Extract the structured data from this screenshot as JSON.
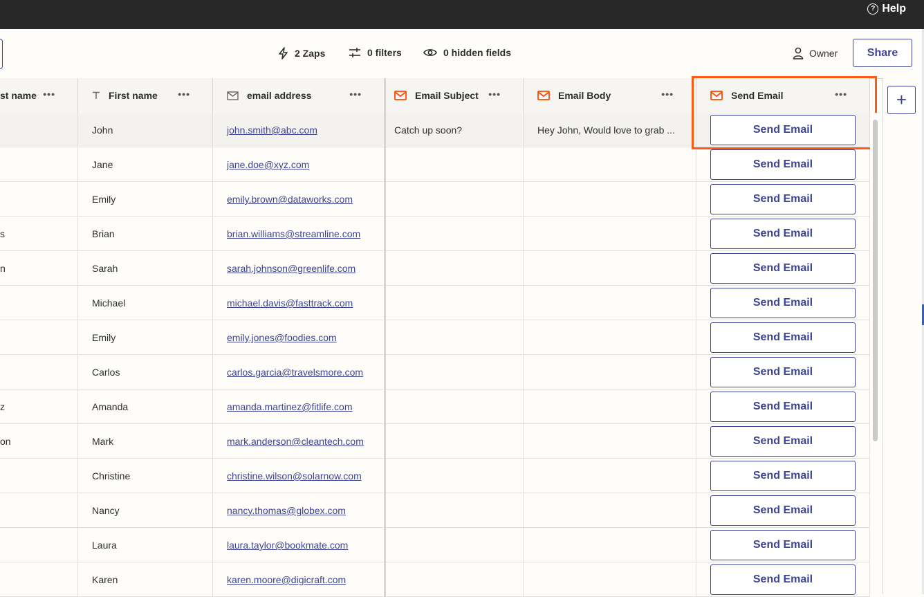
{
  "topbar": {
    "help_label": "Help",
    "help_glyph": "?"
  },
  "toolbar": {
    "zaps_label": "2 Zaps",
    "filters_label": "0 filters",
    "hidden_label": "0 hidden fields",
    "owner_label": "Owner",
    "share_label": "Share"
  },
  "columns": {
    "last_name": "st name",
    "first_name": "First name",
    "email": "email address",
    "subject": "Email Subject",
    "body": "Email Body",
    "send": "Send Email",
    "dots": "•••"
  },
  "rows": [
    {
      "last": "",
      "first": "John",
      "email": "john.smith@abc.com",
      "subject": "Catch up soon?",
      "body": "Hey John, Would love to grab ...",
      "button": "Send Email"
    },
    {
      "last": "",
      "first": "Jane",
      "email": "jane.doe@xyz.com",
      "subject": "",
      "body": "",
      "button": "Send Email"
    },
    {
      "last": "",
      "first": "Emily",
      "email": "emily.brown@dataworks.com",
      "subject": "",
      "body": "",
      "button": "Send Email"
    },
    {
      "last": "s",
      "first": "Brian",
      "email": "brian.williams@streamline.com",
      "subject": "",
      "body": "",
      "button": "Send Email"
    },
    {
      "last": "n",
      "first": "Sarah",
      "email": "sarah.johnson@greenlife.com",
      "subject": "",
      "body": "",
      "button": "Send Email"
    },
    {
      "last": "",
      "first": "Michael",
      "email": "michael.davis@fasttrack.com",
      "subject": "",
      "body": "",
      "button": "Send Email"
    },
    {
      "last": "",
      "first": "Emily",
      "email": "emily.jones@foodies.com",
      "subject": "",
      "body": "",
      "button": "Send Email"
    },
    {
      "last": "",
      "first": "Carlos",
      "email": "carlos.garcia@travelsmore.com",
      "subject": "",
      "body": "",
      "button": "Send Email"
    },
    {
      "last": "z",
      "first": "Amanda",
      "email": "amanda.martinez@fitlife.com",
      "subject": "",
      "body": "",
      "button": "Send Email"
    },
    {
      "last": "on",
      "first": "Mark",
      "email": "mark.anderson@cleantech.com",
      "subject": "",
      "body": "",
      "button": "Send Email"
    },
    {
      "last": "",
      "first": "Christine",
      "email": "christine.wilson@solarnow.com",
      "subject": "",
      "body": "",
      "button": "Send Email"
    },
    {
      "last": "",
      "first": "Nancy",
      "email": "nancy.thomas@globex.com",
      "subject": "",
      "body": "",
      "button": "Send Email"
    },
    {
      "last": "",
      "first": "Laura",
      "email": "laura.taylor@bookmate.com",
      "subject": "",
      "body": "",
      "button": "Send Email"
    },
    {
      "last": "",
      "first": "Karen",
      "email": "karen.moore@digicraft.com",
      "subject": "",
      "body": "",
      "button": "Send Email"
    }
  ],
  "add_column_glyph": "+",
  "colors": {
    "accent": "#3d4592",
    "highlight": "#ff5a10",
    "email_icon": "#ff4a00"
  }
}
